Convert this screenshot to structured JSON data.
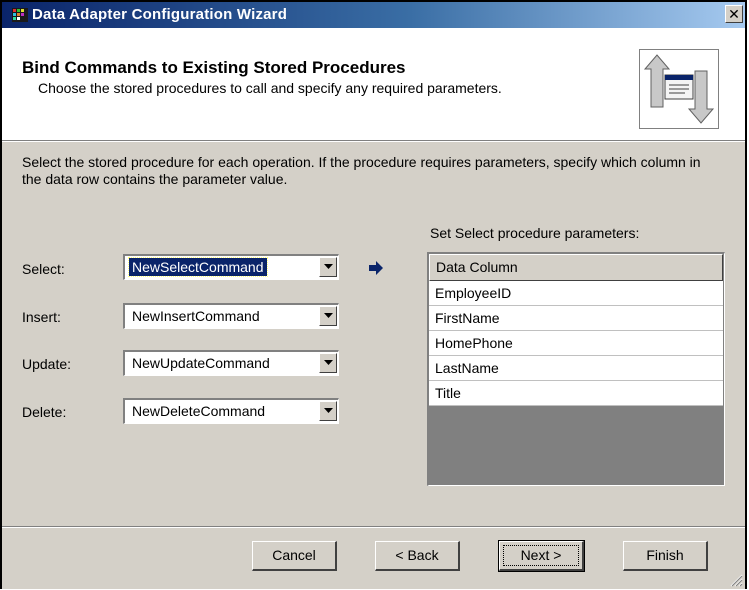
{
  "window": {
    "title": "Data Adapter Configuration Wizard",
    "close_glyph": "✕"
  },
  "header": {
    "title": "Bind Commands to Existing Stored Procedures",
    "subtitle": "Choose the stored procedures to call and specify any required parameters.",
    "icon": "wizard-bind-icon"
  },
  "instructions": "Select the stored procedure for each operation. If the procedure requires parameters, specify which column in the data row contains the parameter value.",
  "operations": [
    {
      "label": "Select:",
      "value": "NewSelectCommand",
      "selected": true
    },
    {
      "label": "Insert:",
      "value": "NewInsertCommand",
      "selected": false
    },
    {
      "label": "Update:",
      "value": "NewUpdateCommand",
      "selected": false
    },
    {
      "label": "Delete:",
      "value": "NewDeleteCommand",
      "selected": false
    }
  ],
  "current_operation_icon": "arrow-right-icon",
  "parameters": {
    "label": "Set Select procedure parameters:",
    "column_header": "Data Column",
    "rows": [
      "EmployeeID",
      "FirstName",
      "HomePhone",
      "LastName",
      "Title"
    ]
  },
  "buttons": {
    "cancel": "Cancel",
    "back": "< Back",
    "next": "Next >",
    "finish": "Finish"
  },
  "colors": {
    "title_bar": "#0a246a",
    "dialog_face": "#d4d0c8",
    "selection": "#0a246a",
    "arrow": "#0a246a"
  }
}
